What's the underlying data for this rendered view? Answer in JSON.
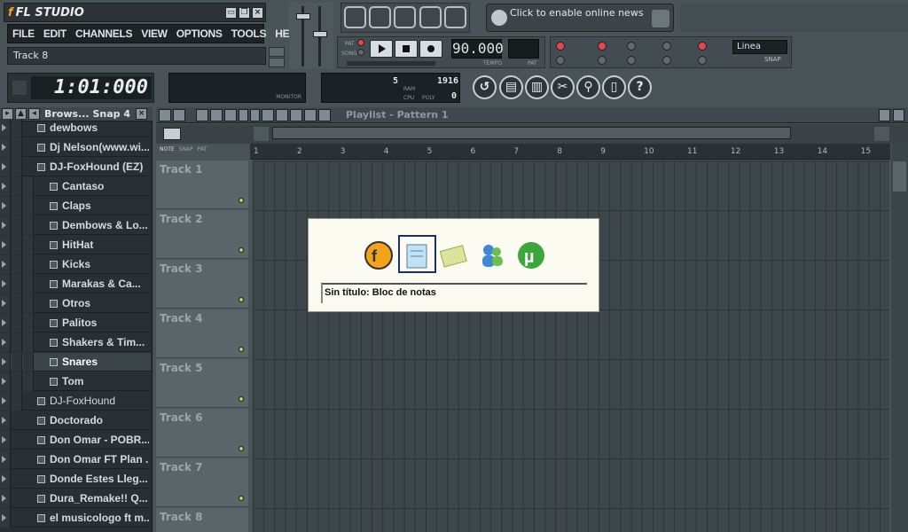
{
  "app": {
    "logo": "FL STUDIO"
  },
  "menu": [
    "FILE",
    "EDIT",
    "CHANNELS",
    "VIEW",
    "OPTIONS",
    "TOOLS",
    "HELP"
  ],
  "hint": "Track 8",
  "transport": {
    "tempo": "90.000",
    "tempo_label": "TEMPO",
    "pat_label": "PAT",
    "pat_mode": "PAT",
    "song_mode": "SONG"
  },
  "news": "Click to enable online news",
  "snap_value": "Linea",
  "snap_label": "SNAP",
  "time_display": "1:01:000",
  "monitor_label": "MONITOR",
  "cpu": {
    "left": "5",
    "right": "1916",
    "ram": "RAM",
    "cpu": "CPU",
    "poly": "POLY",
    "poly_val": "0"
  },
  "browser": {
    "title": "Brows... Snap 4",
    "items": [
      {
        "label": "dewbows",
        "level": 1
      },
      {
        "label": "Dj Nelson(www.wi...",
        "level": 1
      },
      {
        "label": "DJ-FoxHound (EZ)",
        "level": 1
      },
      {
        "label": "Cantaso",
        "level": 2
      },
      {
        "label": "Claps",
        "level": 2
      },
      {
        "label": "Dembows & Lo...",
        "level": 2
      },
      {
        "label": "HitHat",
        "level": 2
      },
      {
        "label": "Kicks",
        "level": 2
      },
      {
        "label": "Marakas & Ca...",
        "level": 2
      },
      {
        "label": "Otros",
        "level": 2
      },
      {
        "label": "Palitos",
        "level": 2
      },
      {
        "label": "Shakers & Tim...",
        "level": 2
      },
      {
        "label": "Snares",
        "level": 2,
        "selected": true
      },
      {
        "label": "Tom",
        "level": 2
      },
      {
        "label": "DJ-FoxHound",
        "level": 1,
        "file": true
      },
      {
        "label": "Doctorado",
        "level": 0
      },
      {
        "label": "Don Omar - POBR...",
        "level": 0
      },
      {
        "label": "Don Omar FT Plan ...",
        "level": 0
      },
      {
        "label": "Donde Estes Lleg...",
        "level": 0
      },
      {
        "label": "Dura_Remake!! Q...",
        "level": 0
      },
      {
        "label": "el musicologo ft m...",
        "level": 0
      }
    ]
  },
  "playlist": {
    "title": "Playlist - Pattern 1",
    "tabs": [
      "NOTE",
      "SNAP",
      "PAT"
    ],
    "ruler": [
      "1",
      "2",
      "3",
      "4",
      "5",
      "6",
      "7",
      "8",
      "9",
      "10",
      "11",
      "12",
      "13",
      "14",
      "15"
    ],
    "tracks": [
      "Track 1",
      "Track 2",
      "Track 3",
      "Track 4",
      "Track 5",
      "Track 6",
      "Track 7",
      "Track 8"
    ]
  },
  "switcher": {
    "caption": "Sin título: Bloc de notas",
    "apps": [
      "fl-studio-icon",
      "notepad-icon",
      "notes-folder-icon",
      "messenger-icon",
      "utorrent-icon"
    ]
  }
}
